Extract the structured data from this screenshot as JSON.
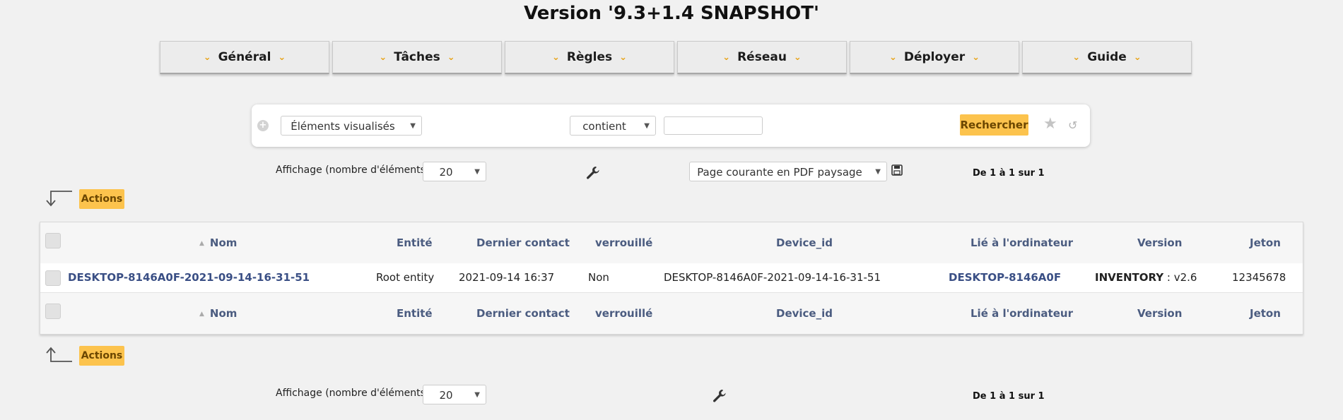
{
  "title": "Version '9.3+1.4 SNAPSHOT'",
  "menu": [
    {
      "label": "Général"
    },
    {
      "label": "Tâches"
    },
    {
      "label": "Règles"
    },
    {
      "label": "Réseau"
    },
    {
      "label": "Déployer"
    },
    {
      "label": "Guide"
    }
  ],
  "search": {
    "field_select": "Éléments visualisés",
    "operator_select": "contient",
    "value": "",
    "search_button": "Rechercher"
  },
  "pager_top": {
    "display_label": "Affichage (nombre d'éléments)",
    "display_value": "20",
    "export_select": "Page courante en PDF paysage",
    "range_text": "De 1 à 1 sur 1"
  },
  "pager_bottom": {
    "display_label": "Affichage (nombre d'éléments)",
    "display_value": "20",
    "range_text": "De 1 à 1 sur 1"
  },
  "actions_label": "Actions",
  "table": {
    "columns": [
      "Nom",
      "Entité",
      "Dernier contact",
      "verrouillé",
      "Device_id",
      "Lié à l'ordinateur",
      "Version",
      "Jeton"
    ],
    "rows": [
      {
        "nom": "DESKTOP-8146A0F-2021-09-14-16-31-51",
        "entite": "Root entity",
        "dernier_contact": "2021-09-14 16:37",
        "verrouille": "Non",
        "device_id": "DESKTOP-8146A0F-2021-09-14-16-31-51",
        "lie_ordinateur": "DESKTOP-8146A0F",
        "version_key": "INVENTORY",
        "version_val": " : v2.6",
        "jeton": "12345678"
      }
    ]
  },
  "colors": {
    "accent": "#fcc34d",
    "chevron": "#e8a317",
    "link": "#3a4f85"
  }
}
